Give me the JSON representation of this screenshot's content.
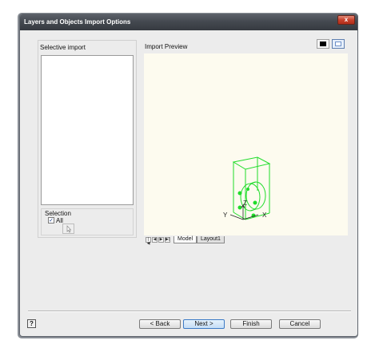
{
  "window": {
    "title": "Layers and Objects Import Options",
    "close_glyph": "x"
  },
  "left_panel": {
    "label": "Selective import",
    "items": []
  },
  "selection": {
    "label": "Selection",
    "all_label": "All",
    "all_checked": true,
    "check_glyph": "✓",
    "select_icon": "cursor-select-icon"
  },
  "preview": {
    "label": "Import Preview",
    "background_color": "#fdfbef",
    "wire_color": "#1fdc2a",
    "axis_labels": {
      "x": "X",
      "y": "Y",
      "z": "Z"
    },
    "background_toggles": [
      {
        "name": "black",
        "color": "#000000"
      },
      {
        "name": "white",
        "color": "#ffffff",
        "active": true
      }
    ]
  },
  "tabs": {
    "nav_glyphs": [
      "|◀",
      "◀",
      "▶",
      "▶|"
    ],
    "items": [
      {
        "label": "Model",
        "active": true
      },
      {
        "label": "Layout1",
        "active": false
      }
    ]
  },
  "footer": {
    "help_label": "?",
    "back_label": "< Back",
    "next_label": "Next >",
    "finish_label": "Finish",
    "cancel_label": "Cancel"
  }
}
